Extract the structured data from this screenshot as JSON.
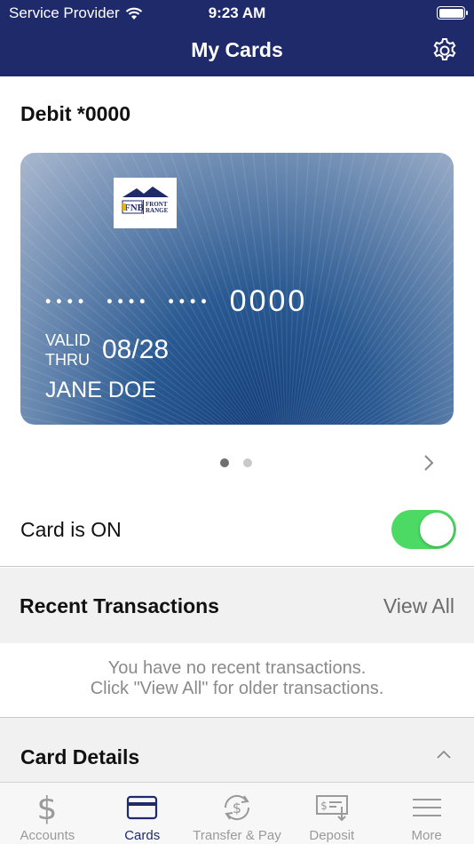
{
  "status_bar": {
    "carrier": "Service Provider",
    "time": "9:23 AM"
  },
  "nav": {
    "title": "My Cards",
    "settings_icon": "gear-icon"
  },
  "card_section": {
    "title": "Debit *0000",
    "card": {
      "masked_groups": [
        "••••",
        "••••",
        "••••"
      ],
      "last4": "0000",
      "valid_label_1": "VALID",
      "valid_label_2": "THRU",
      "expiry": "08/28",
      "holder": "JANE DOE",
      "logo_text": "FNB FRONT RANGE"
    },
    "pager": {
      "total": 2,
      "current": 1
    }
  },
  "card_toggle": {
    "label": "Card is ON",
    "on": true,
    "on_color": "#4cd964"
  },
  "recent_transactions": {
    "title": "Recent Transactions",
    "view_all": "View All",
    "empty_line_1": "You have no recent transactions.",
    "empty_line_2": "Click \"View All\" for older transactions."
  },
  "card_details": {
    "title": "Card Details"
  },
  "tabbar": {
    "tabs": [
      {
        "label": "Accounts",
        "icon": "dollar-icon",
        "active": false
      },
      {
        "label": "Cards",
        "icon": "card-icon",
        "active": true
      },
      {
        "label": "Transfer & Pay",
        "icon": "transfer-icon",
        "active": false
      },
      {
        "label": "Deposit",
        "icon": "deposit-icon",
        "active": false
      },
      {
        "label": "More",
        "icon": "menu-icon",
        "active": false
      }
    ]
  },
  "colors": {
    "nav_bg": "#1f2a6b",
    "accent": "#1f2a6b",
    "toggle_on": "#4cd964"
  }
}
